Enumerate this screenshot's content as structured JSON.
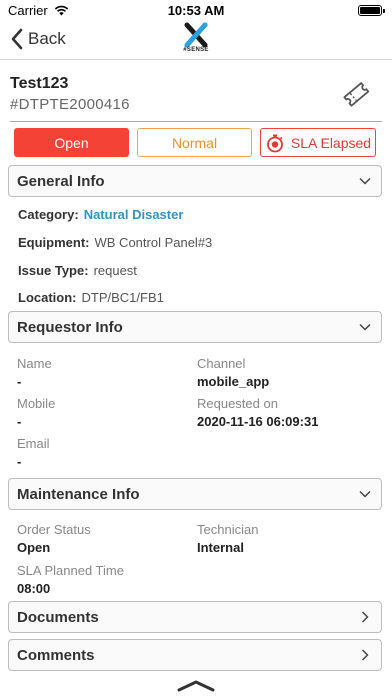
{
  "status_bar": {
    "carrier": "Carrier",
    "time": "10:53 AM",
    "battery_level": 1.0
  },
  "nav": {
    "back_label": "Back",
    "logo_text": "#SENSE"
  },
  "ticket": {
    "title": "Test123",
    "id": "#DTPTE2000416"
  },
  "badges": {
    "status": "Open",
    "priority": "Normal",
    "sla": "SLA Elapsed"
  },
  "colors": {
    "open": "#f44336",
    "normal": "#f0902a",
    "sla": "#e53935",
    "link": "#2a95c9"
  },
  "general_info": {
    "title": "General Info",
    "category_label": "Category:",
    "category_value": "Natural Disaster",
    "equipment_label": "Equipment:",
    "equipment_value": "WB Control Panel#3",
    "issue_type_label": "Issue Type:",
    "issue_type_value": "request",
    "location_label": "Location:",
    "location_value": "DTP/BC1/FB1"
  },
  "requestor_info": {
    "title": "Requestor Info",
    "name_label": "Name",
    "name_value": "-",
    "channel_label": "Channel",
    "channel_value": "mobile_app",
    "mobile_label": "Mobile",
    "mobile_value": "-",
    "requested_on_label": "Requested on",
    "requested_on_value": "2020-11-16 06:09:31",
    "email_label": "Email",
    "email_value": "-"
  },
  "maintenance_info": {
    "title": "Maintenance Info",
    "order_status_label": "Order Status",
    "order_status_value": "Open",
    "technician_label": "Technician",
    "technician_value": "Internal",
    "sla_planned_label": "SLA Planned Time",
    "sla_planned_value": "08:00"
  },
  "documents": {
    "title": "Documents"
  },
  "comments": {
    "title": "Comments"
  },
  "icons": [
    "wifi-icon",
    "chevron-left-icon",
    "logo-icon",
    "ticket-icon",
    "stopwatch-icon",
    "chevron-down-icon",
    "chevron-right-icon",
    "chevron-up-icon"
  ]
}
